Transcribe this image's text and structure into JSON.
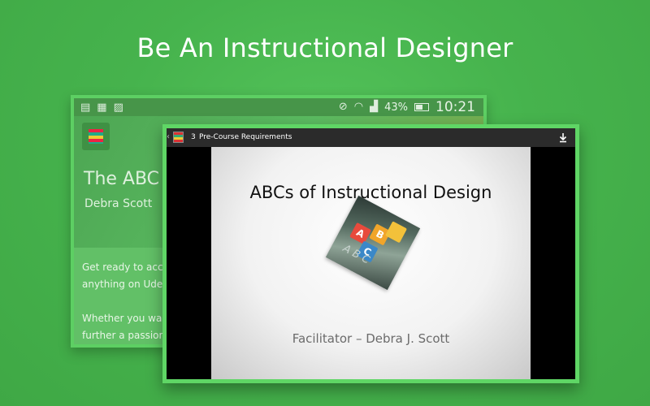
{
  "headline": "Be An Instructional Designer",
  "back_screen": {
    "status_bar": {
      "icons_left": [
        "notification-icon",
        "alert-icon",
        "image-icon"
      ],
      "icons_right": [
        "mute-icon",
        "wifi-icon",
        "signal-icon"
      ],
      "battery_percent": "43%",
      "time": "10:21"
    },
    "course_title": "The ABC",
    "author": "Debra Scott",
    "description_lines": [
      "Get ready to acce",
      "anything on Uder",
      "Whether you wan",
      "further a passion,"
    ]
  },
  "front_screen": {
    "topbar": {
      "lecture_number": "3",
      "lecture_title": "Pre-Course Requirements"
    },
    "slide": {
      "title": "ABCs of Instructional Design",
      "image_blocks": [
        "A",
        "B",
        "C",
        ""
      ],
      "image_script": "A B C",
      "facilitator": "Facilitator – Debra J. Scott"
    }
  }
}
